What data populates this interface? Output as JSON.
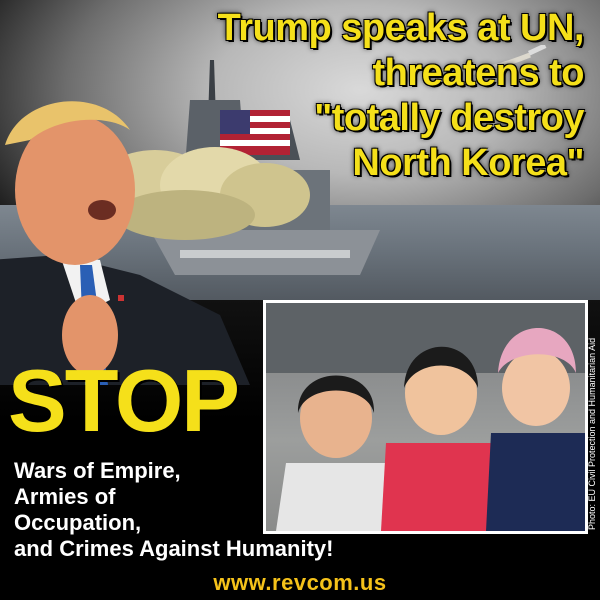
{
  "headline": {
    "line1": "Trump speaks at UN,",
    "line2": "threatens to",
    "line3": "\"totally destroy",
    "line4": "North Korea\""
  },
  "stop_text": "STOP",
  "slogan": {
    "line1": "Wars of Empire,",
    "line2": "Armies of",
    "line3": "Occupation,",
    "line4": "and Crimes Against Humanity!"
  },
  "website": "www.revcom.us",
  "photo_credit": "Photo: EU Civil Protection and Humanitarian Aid",
  "colors": {
    "headline": "#f5e01a",
    "stop": "#f5e01a",
    "url": "#f5c21a",
    "slogan": "#ffffff"
  }
}
